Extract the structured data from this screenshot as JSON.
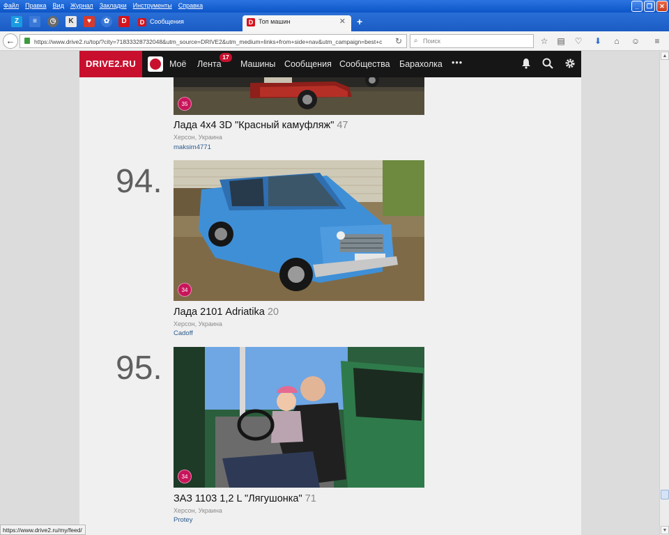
{
  "menu": [
    "Файл",
    "Правка",
    "Вид",
    "Журнал",
    "Закладки",
    "Инструменты",
    "Справка"
  ],
  "tabs": {
    "inactive_label": "Сообщения",
    "active_label": "Топ машин",
    "favicon_letter": "D"
  },
  "url": "https://www.drive2.ru/top/?city=71833328732048&utm_source=DRIVE2&utm_medium=links+from+side+nav&utm_campaign=best+c",
  "search_placeholder": "Поиск",
  "site": {
    "logo": "DRIVE2.RU",
    "nav": [
      "Моё",
      "Лента",
      "Машины",
      "Сообщения",
      "Сообщества",
      "Барахолка",
      "•••"
    ],
    "feed_badge": "17"
  },
  "cars": [
    {
      "rank": "",
      "badge": "35",
      "title": "Лада 4x4 3D \"Красный камуфляж\"",
      "count": "47",
      "city": "Херсон, Украина",
      "author": "maksim4771"
    },
    {
      "rank": "94.",
      "badge": "34",
      "title": "Лада 2101 Adriatika",
      "count": "20",
      "city": "Херсон, Украина",
      "author": "Cadoff"
    },
    {
      "rank": "95.",
      "badge": "34",
      "title": "ЗАЗ 1103 1,2 L \"Лягушонка\"",
      "count": "71",
      "city": "Херсон, Украина",
      "author": "Protey"
    }
  ],
  "status_url": "https://www.drive2.ru/my/feed/",
  "colors": {
    "brand_red": "#c8102e",
    "badge_pink": "#c8145a",
    "header_dark": "#161616",
    "link_blue": "#2a5a8c"
  }
}
